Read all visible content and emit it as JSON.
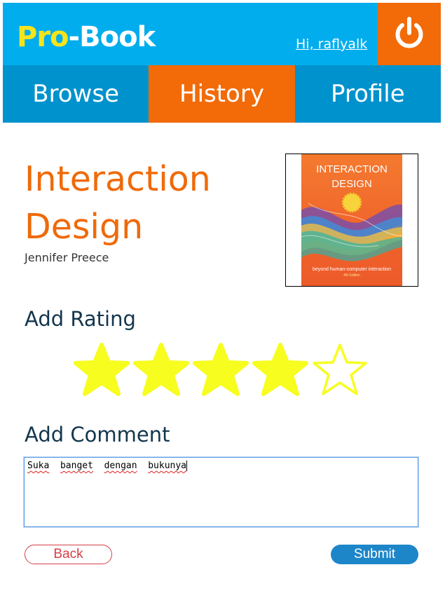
{
  "header": {
    "logo_part1": "Pro",
    "logo_part2": "-Book",
    "greeting": "Hi, raflyalk",
    "logout_icon": "power-icon"
  },
  "nav": {
    "tabs": [
      {
        "label": "Browse",
        "active": false
      },
      {
        "label": "History",
        "active": true
      },
      {
        "label": "Profile",
        "active": false
      }
    ]
  },
  "book": {
    "title": "Interaction Design",
    "author": "Jennifer Preece",
    "cover": {
      "title": "INTERACTION DESIGN",
      "subtitle": "beyond human-computer interaction",
      "edition": "4th Edition"
    }
  },
  "rating": {
    "heading": "Add Rating",
    "value": 4,
    "max": 5
  },
  "comment": {
    "heading": "Add Comment",
    "words": [
      "Suka",
      "banget",
      "dengan",
      "bukunya"
    ]
  },
  "actions": {
    "back_label": "Back",
    "submit_label": "Submit"
  },
  "colors": {
    "header_bg": "#01aded",
    "nav_bg": "#0092cd",
    "accent_orange": "#f26b08",
    "logo_yellow": "#f6e41c",
    "star_fill": "#f7fd1f",
    "title_orange": "#ef6a0a",
    "heading_navy": "#13364d",
    "submit_blue": "#1d86c9",
    "back_red": "#d63f47"
  }
}
